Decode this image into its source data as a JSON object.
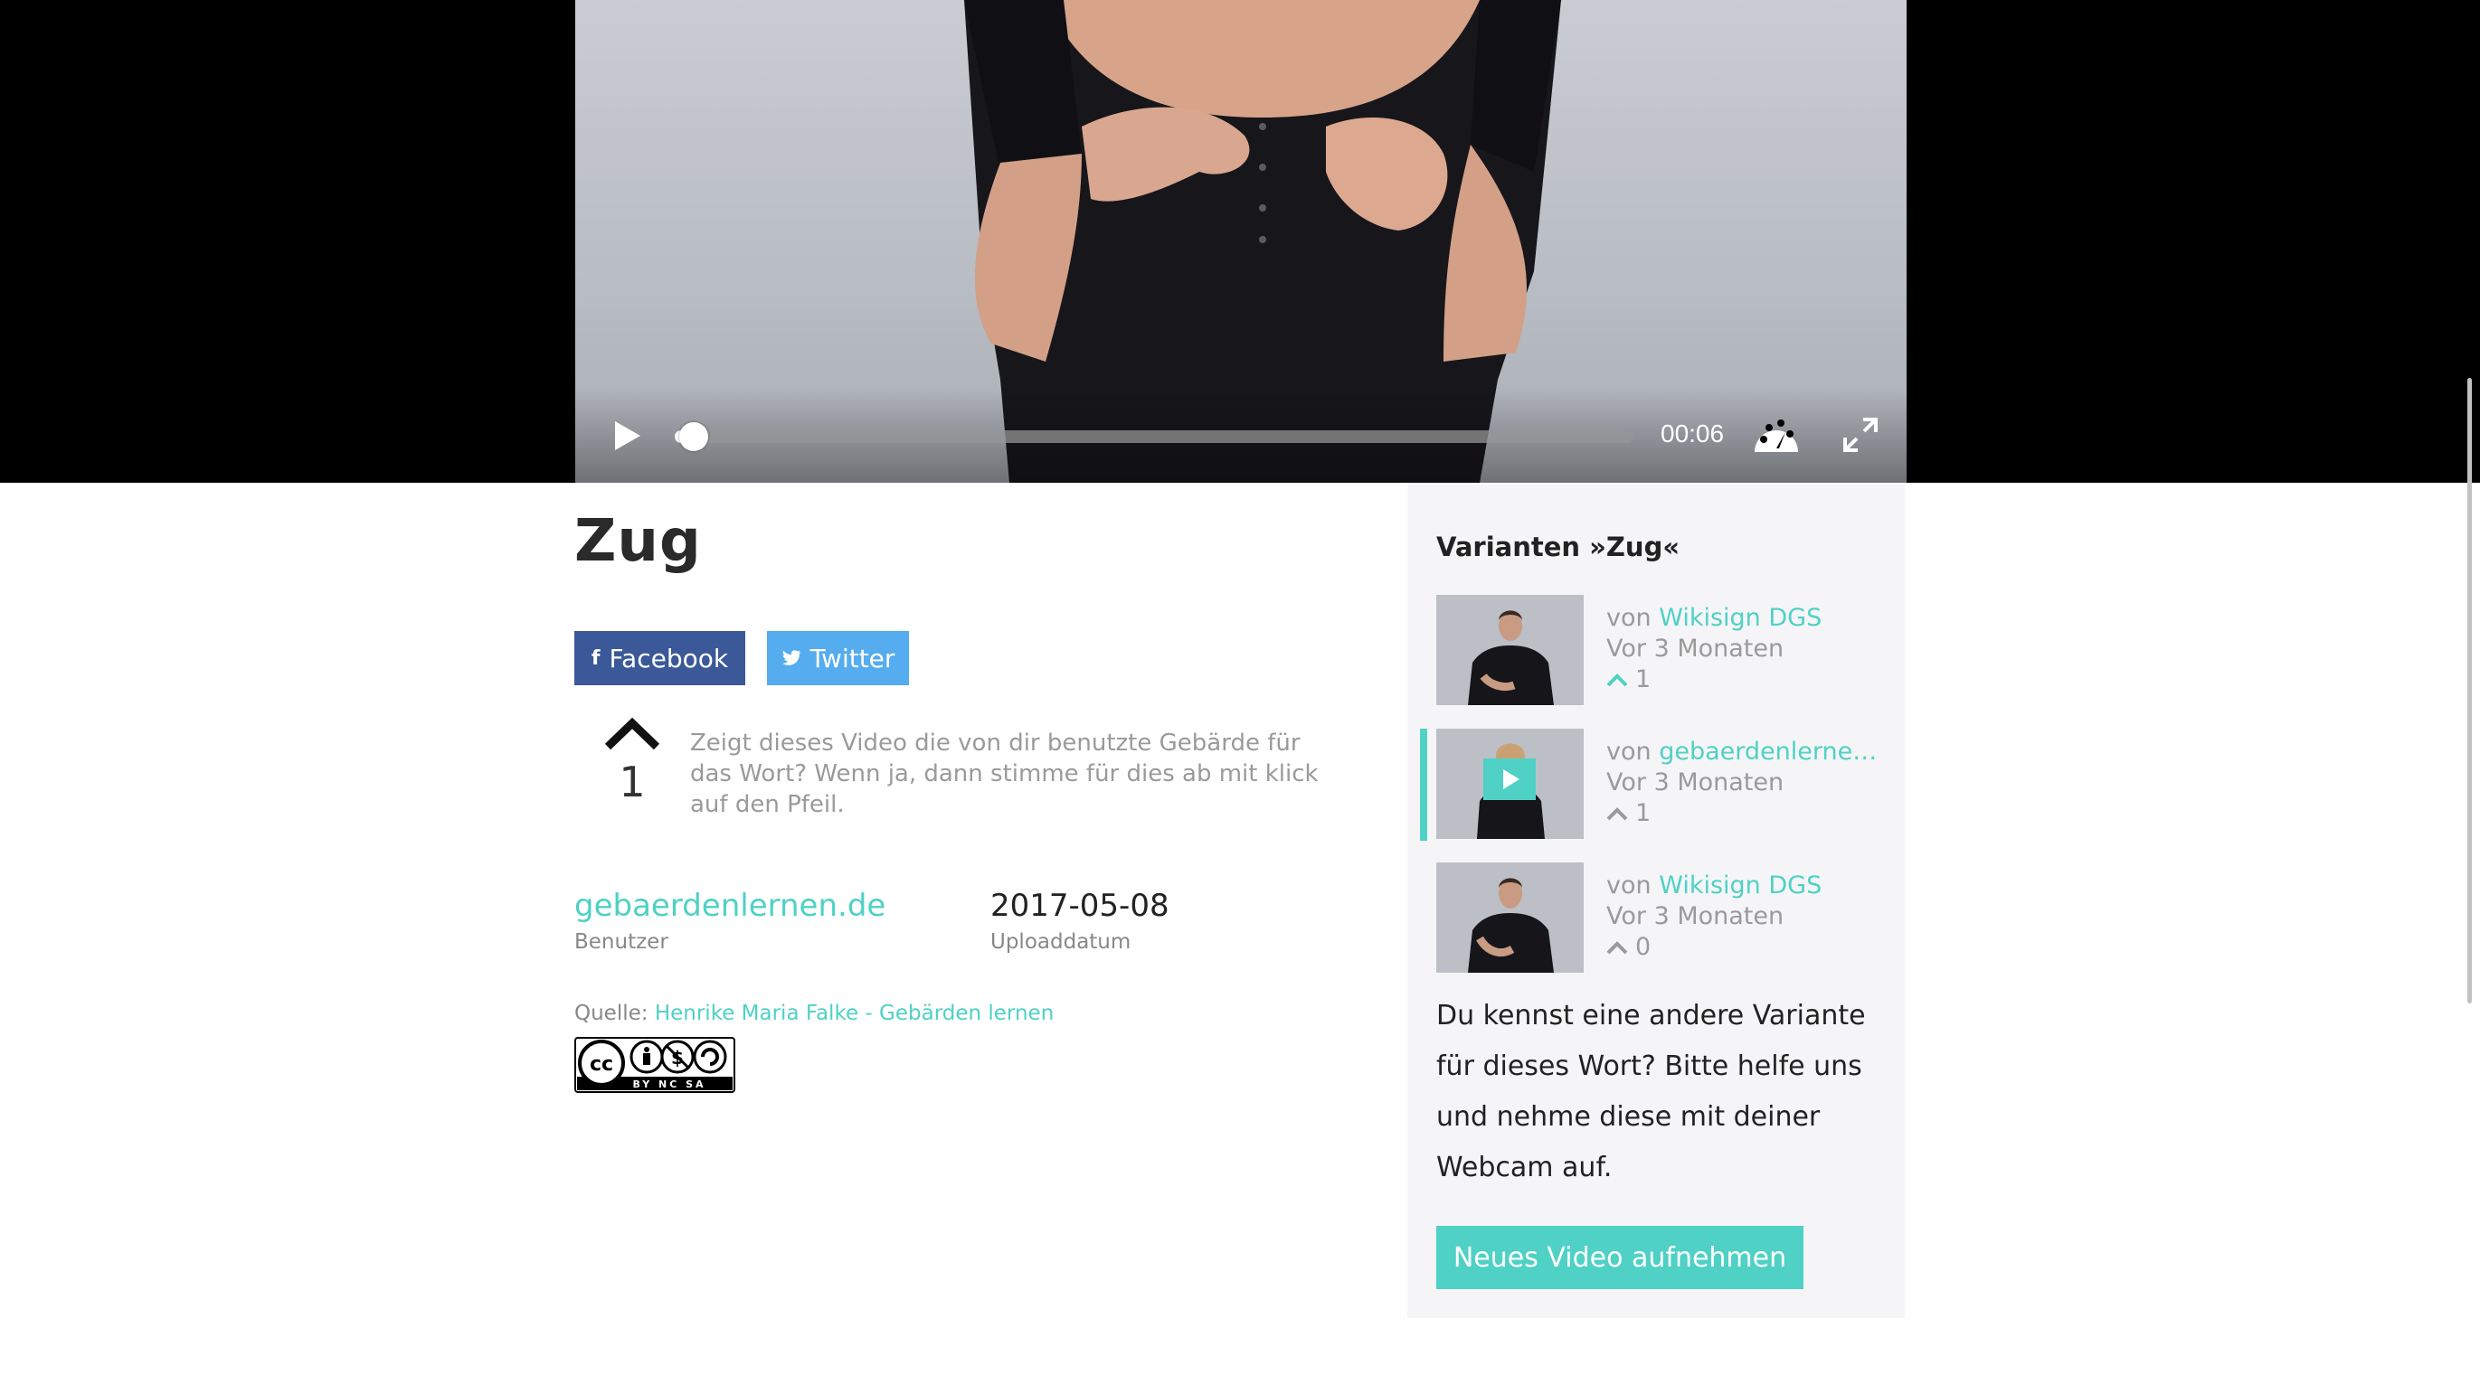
{
  "player": {
    "time": "00:06",
    "progress": 0.02
  },
  "page": {
    "title": "Zug"
  },
  "share": {
    "facebook_label": "Facebook",
    "twitter_label": "Twitter"
  },
  "vote": {
    "count": "1",
    "help": "Zeigt dieses Video die von dir benutzte Gebärde für das Wort? Wenn ja, dann stimme für dies ab mit klick auf den Pfeil."
  },
  "meta": {
    "user": "gebaerdenlernen.de",
    "user_label": "Benutzer",
    "date": "2017-05-08",
    "date_label": "Uploaddatum"
  },
  "source": {
    "label": "Quelle:",
    "link": "Henrike Maria Falke - Gebärden lernen"
  },
  "license": {
    "badge": "cc-by-nc-sa-badge",
    "text": "BY NC SA"
  },
  "sidebar": {
    "title": "Varianten »Zug«",
    "variants": [
      {
        "by": "von",
        "author": "Wikisign DGS",
        "age": "Vor 3 Monaten",
        "votes": "1",
        "arrow_color": "#4fd1c5",
        "active": false
      },
      {
        "by": "von",
        "author": "gebaerdenlerne…",
        "age": "Vor 3 Monaten",
        "votes": "1",
        "arrow_color": "#9a9a9a",
        "active": true
      },
      {
        "by": "von",
        "author": "Wikisign DGS",
        "age": "Vor 3 Monaten",
        "votes": "0",
        "arrow_color": "#9a9a9a",
        "active": false
      }
    ],
    "prompt": "Du kennst eine andere Variante für dieses Wort? Bitte helfe uns und nehme diese mit deiner Webcam auf.",
    "record_button": "Neues Video aufnehmen"
  },
  "colors": {
    "accent": "#4fd1c5",
    "facebook": "#3b5998",
    "twitter": "#55acee"
  }
}
